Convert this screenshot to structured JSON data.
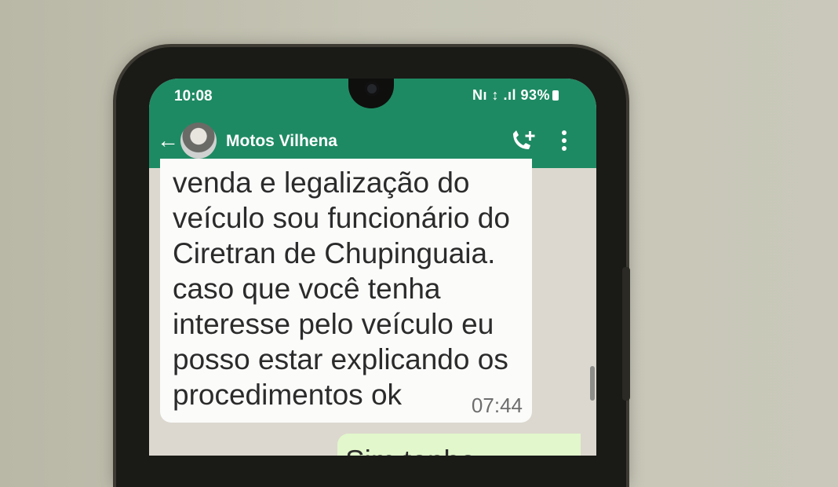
{
  "status_bar": {
    "time": "10:08",
    "indicators": "Nı ↕ .ıl 93%"
  },
  "header": {
    "contact_name": "Motos Vilhena",
    "icons": [
      "back-arrow",
      "avatar",
      "add-call",
      "more-vertical"
    ]
  },
  "messages": [
    {
      "direction": "incoming",
      "text": "venda e legalização do\nveículo sou funcionário do\nCiretran de Chupinguaia.\ncaso que você tenha\ninteresse pelo veículo eu\nposso estar explicando os\nprocedimentos ok",
      "time": "07:44"
    },
    {
      "direction": "outgoing",
      "text": "Sim tenho"
    }
  ],
  "colors": {
    "app_bar": "#1e8a63",
    "incoming_bubble": "#fbfbfa",
    "outgoing_bubble": "#e2f7cb",
    "chat_background": "#dcd8cf"
  }
}
